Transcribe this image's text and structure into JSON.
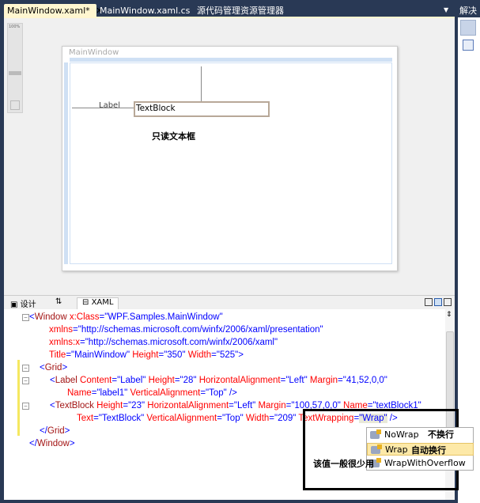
{
  "tabs": [
    {
      "label": "MainWindow.xaml*",
      "active": true
    },
    {
      "label": "MainWindow.xaml.cs"
    },
    {
      "label": "源代码管理资源管理器"
    }
  ],
  "right_panel_title": "解决",
  "zoom_level": "100%",
  "designer": {
    "window_title": "MainWindow",
    "label_text": "Label",
    "textblock_text": "TextBlock",
    "annotation": "只读文本框"
  },
  "bottom_tabs": {
    "design": "设计",
    "swap": "⇅",
    "xaml": "XAML"
  },
  "code": {
    "l1": [
      "<",
      "Window",
      " x:Class",
      "=",
      "\"WPF.Samples.MainWindow\""
    ],
    "l2": [
      "xmlns",
      "=",
      "\"http://schemas.microsoft.com/winfx/2006/xaml/presentation\""
    ],
    "l3": [
      "xmlns:x",
      "=",
      "\"http://schemas.microsoft.com/winfx/2006/xaml\""
    ],
    "l4": [
      "Title",
      "=",
      "\"MainWindow\"",
      " Height",
      "=",
      "\"350\"",
      " Width",
      "=",
      "\"525\"",
      ">"
    ],
    "l5": [
      "<",
      "Grid",
      ">"
    ],
    "l6": [
      "<",
      "Label",
      " Content",
      "=",
      "\"Label\"",
      " Height",
      "=",
      "\"28\"",
      " HorizontalAlignment",
      "=",
      "\"Left\"",
      " Margin",
      "=",
      "\"41,52,0,0\""
    ],
    "l7": [
      "Name",
      "=",
      "\"label1\"",
      " VerticalAlignment",
      "=",
      "\"Top\"",
      " />"
    ],
    "l8": [
      "<",
      "TextBlock",
      " Height",
      "=",
      "\"23\"",
      " HorizontalAlignment",
      "=",
      "\"Left\"",
      " Margin",
      "=",
      "\"100,57,0,0\"",
      " Name",
      "=",
      "\"textBlock1\""
    ],
    "l9": [
      "Text",
      "=",
      "\"TextBlock\"",
      " VerticalAlignment",
      "=",
      "\"Top\"",
      " Width",
      "=",
      "\"209\"",
      " TextWrapping",
      "=",
      "\"Wrap\"",
      " />"
    ],
    "l10": [
      "</",
      "Grid",
      ">"
    ],
    "l11": [
      "</",
      "Window",
      ">"
    ]
  },
  "completion": {
    "items": [
      "NoWrap",
      "Wrap",
      "WrapWithOverflow"
    ],
    "selected": "Wrap"
  },
  "notes": {
    "nowrap": "不换行",
    "wrap": "自动换行",
    "overflow": "该值一般很少用"
  }
}
